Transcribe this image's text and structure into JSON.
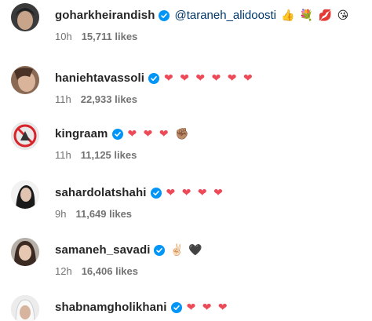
{
  "comments": [
    {
      "username": "goharkheirandish",
      "mention": "@taraneh_alidoosti",
      "text": "👍 💐 💋 😘",
      "time": "10h",
      "likes": "15,711 likes"
    },
    {
      "username": "haniehtavassoli",
      "text": "❤ ❤ ❤ ❤ ❤ ❤",
      "time": "11h",
      "likes": "22,933 likes"
    },
    {
      "username": "kingraam",
      "text": "❤ ❤ ❤ ✊🏽",
      "time": "11h",
      "likes": "11,125 likes"
    },
    {
      "username": "sahardolatshahi",
      "text": "❤ ❤ ❤ ❤",
      "time": "9h",
      "likes": "11,649 likes"
    },
    {
      "username": "samaneh_savadi",
      "text": "✌🏻 🖤",
      "time": "12h",
      "likes": "16,406 likes"
    },
    {
      "username": "shabnamgholikhani",
      "text": "❤ ❤ ❤",
      "time": "",
      "likes": ""
    }
  ],
  "colors": {
    "text": "#262626",
    "meta": "#737373",
    "mention": "#00376b",
    "verified": "#0095f6",
    "heart": "#ed4956"
  },
  "icons": {
    "verified": "verified-badge-icon"
  }
}
